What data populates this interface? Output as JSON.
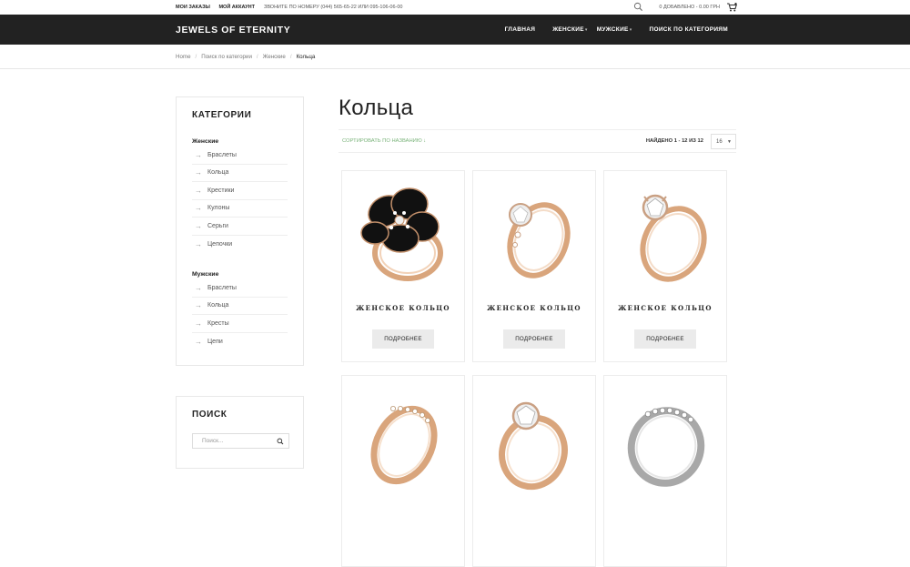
{
  "topbar": {
    "links": [
      "МОИ ЗАКАЗЫ",
      "МОЙ АККАУНТ"
    ],
    "phone": "ЗВОНИТЕ ПО НОМЕРУ (044) 565-65-22 ИЛИ 095-106-06-00",
    "cart_text": "0 ДОБАВЛЕНО - 0.00 ГРН"
  },
  "header": {
    "brand": "JEWELS OF ETERNITY",
    "nav": [
      "ГЛАВНАЯ",
      "ЖЕНСКИЕ",
      "МУЖСКИЕ",
      "ПОИСК ПО КАТЕГОРИЯМ"
    ]
  },
  "breadcrumb": [
    "Home",
    "Поиск по категории",
    "Женские",
    "Кольца"
  ],
  "sidebar": {
    "title": "КАТЕГОРИИ",
    "groups": [
      {
        "name": "Женские",
        "items": [
          "Браслеты",
          "Кольца",
          "Крестики",
          "Кулоны",
          "Серьги",
          "Цепочки"
        ]
      },
      {
        "name": "Мужские",
        "items": [
          "Браслеты",
          "Кольца",
          "Кресты",
          "Цепи"
        ]
      }
    ],
    "search_title": "ПОИСК",
    "search_placeholder": "Поиск..."
  },
  "main": {
    "title": "Кольца",
    "sort_label": "СОРТИРОВАТЬ ПО НАЗВАНИЮ ↓",
    "found_text": "НАЙДЕНО 1 - 12 ИЗ 12",
    "per_page": "16"
  },
  "products": [
    {
      "name": "ЖЕНСКОЕ КОЛЬЦО",
      "button": "ПОДРОБНЕЕ",
      "image_icon": "black-flower-ring-icon"
    },
    {
      "name": "ЖЕНСКОЕ КОЛЬЦО",
      "button": "ПОДРОБНЕЕ",
      "image_icon": "rose-gold-solitaire-ring-icon"
    },
    {
      "name": "ЖЕНСКОЕ КОЛЬЦО",
      "button": "ПОДРОБНЕЕ",
      "image_icon": "rose-gold-solitaire-ring-icon"
    },
    {
      "name": "",
      "button": "",
      "image_icon": "pave-band-ring-icon"
    },
    {
      "name": "",
      "button": "",
      "image_icon": "solitaire-ring-icon"
    },
    {
      "name": "",
      "button": "",
      "image_icon": "silver-pave-band-ring-icon"
    }
  ],
  "colors": {
    "navbar": "#222222",
    "sort_link": "#7ab37a",
    "button_bg": "#ebebeb",
    "gold": "#d9a57c"
  }
}
